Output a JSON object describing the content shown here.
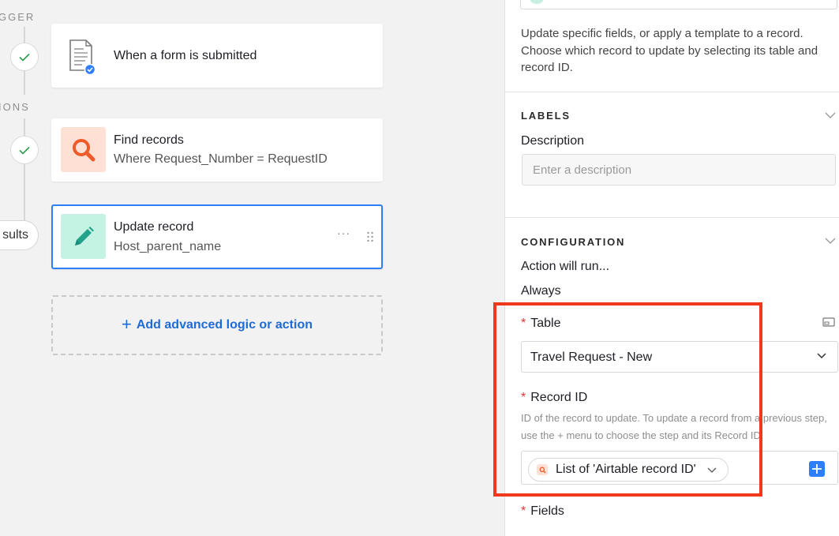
{
  "canvas": {
    "trigger_section_label": "GGER",
    "actions_section_label": "IONS",
    "results_pill_label": "sults",
    "trigger_card": {
      "title": "When a form is submitted"
    },
    "find_card": {
      "title": "Find records",
      "subtitle": "Where Request_Number = RequestID"
    },
    "update_card": {
      "title": "Update record",
      "subtitle": "Host_parent_name",
      "more_label": "···"
    },
    "add_action_label": "Add advanced logic or action"
  },
  "panel": {
    "description": "Update specific fields, or apply a template to a record. Choose which record to update by selecting its table and record ID.",
    "labels_section": {
      "heading": "LABELS",
      "description_label": "Description",
      "description_placeholder": "Enter a description"
    },
    "configuration_section": {
      "heading": "CONFIGURATION",
      "run_label": "Action will run...",
      "run_value": "Always",
      "table_label": "Table",
      "table_value": "Travel Request - New",
      "record_id_label": "Record ID",
      "record_id_help": "ID of the record to update. To update a record from a previous step, use the + menu to choose the step and its Record ID.",
      "record_id_token": "List of 'Airtable record ID'",
      "fields_label": "Fields",
      "required_marker": "*"
    }
  },
  "colors": {
    "accent_blue": "#2d7ff9",
    "find_icon_bg": "#ffe0d5",
    "find_icon_fg": "#f05a28",
    "update_icon_bg": "#c4f3e4",
    "update_icon_fg": "#22a28a",
    "highlight_red": "#f0391a"
  },
  "icons": {
    "trigger": "form-document-icon",
    "find": "search-icon",
    "update": "pencil-icon",
    "check": "check-icon",
    "add": "plus-icon"
  }
}
